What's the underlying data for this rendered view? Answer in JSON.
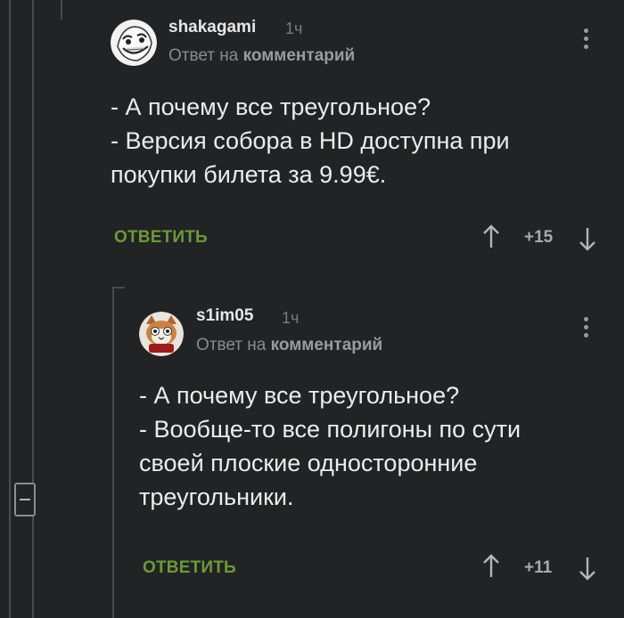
{
  "comments": [
    {
      "username": "shakagami",
      "time": "1ч",
      "reply_prefix": "Ответ на",
      "reply_target": "комментарий",
      "lines": [
        "- А почему все треугольное?",
        "- Версия собора в HD доступна при",
        "покупки билета за 9.99€."
      ],
      "reply_label": "ОТВЕТИТЬ",
      "score": "+15",
      "avatar_icon": "trollface-avatar-icon"
    },
    {
      "username": "s1im05",
      "time": "1ч",
      "reply_prefix": "Ответ на",
      "reply_target": "комментарий",
      "lines": [
        "- А почему все треугольное?",
        "- Вообще-то все полигоны по сути",
        "своей плоские односторонние",
        "треугольники."
      ],
      "reply_label": "ОТВЕТИТЬ",
      "score": "+11",
      "avatar_icon": "cat-avatar-icon"
    }
  ],
  "colors": {
    "background": "#222325",
    "reply_button": "#6b9a38",
    "thread_line": "#4a4b4e"
  }
}
